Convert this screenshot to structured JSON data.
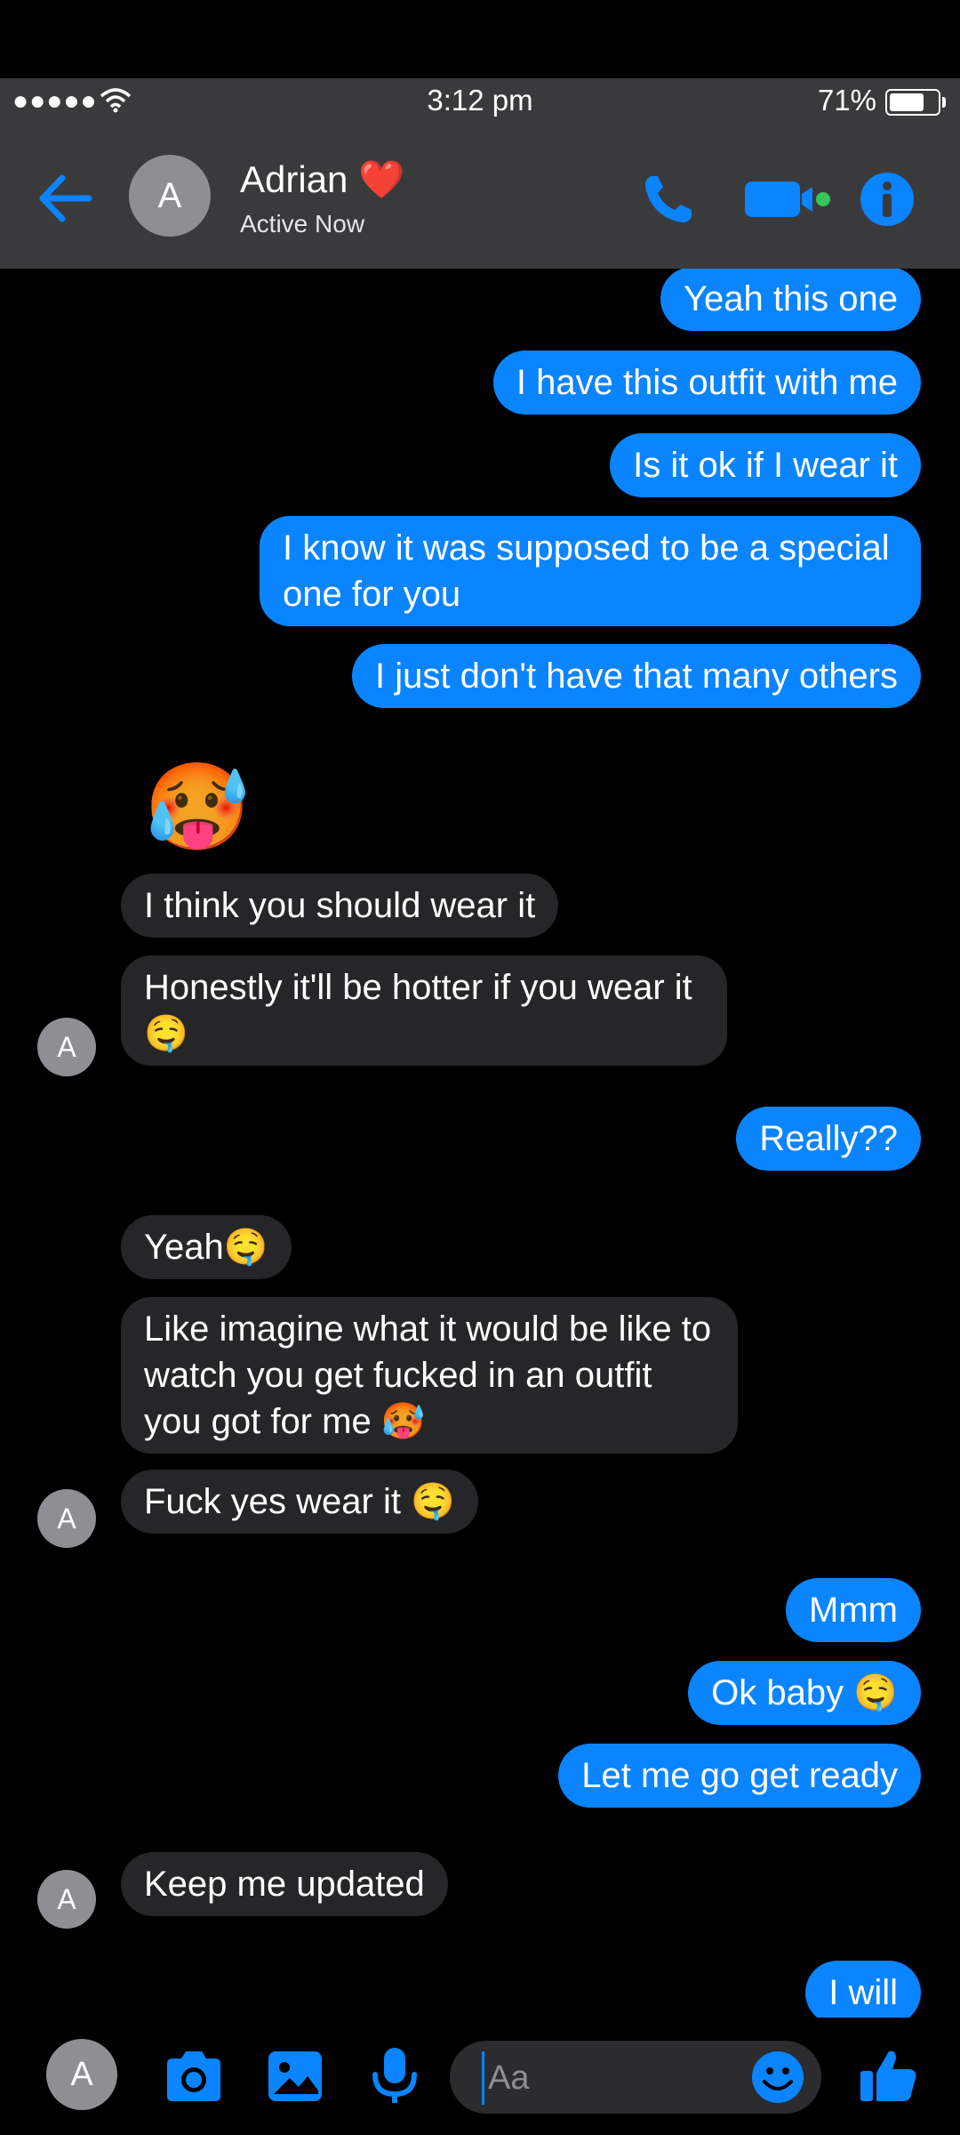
{
  "status_bar": {
    "signal": "●●●●●",
    "time": "3:12 pm",
    "battery_percent": "71%",
    "battery_level": 0.71
  },
  "header": {
    "contact_name": "Adrian",
    "name_emoji": "❤️",
    "contact_status": "Active Now",
    "avatar_initial": "A",
    "accent_color": "#0a84ff",
    "online_color": "#34c759"
  },
  "messages": [
    {
      "side": "out",
      "text": "Yeah this one"
    },
    {
      "side": "out",
      "text": "I have this outfit with me"
    },
    {
      "side": "out",
      "text": "Is it ok if I wear it"
    },
    {
      "side": "out",
      "text": "I know it was supposed to be a special one for you"
    },
    {
      "side": "out",
      "text": "I just don't have that many others"
    },
    {
      "side": "in",
      "text": "🥵"
    },
    {
      "side": "in",
      "text": "I think you should wear it"
    },
    {
      "side": "in",
      "text": "Honestly it'll be hotter if you wear it 🤤"
    },
    {
      "side": "out",
      "text": "Really??"
    },
    {
      "side": "in",
      "text": "Yeah🤤"
    },
    {
      "side": "in",
      "text": "Like imagine what it would be like to watch you get fucked in an outfit you got for me 🥵"
    },
    {
      "side": "in",
      "text": "Fuck yes wear it 🤤"
    },
    {
      "side": "out",
      "text": "Mmm"
    },
    {
      "side": "out",
      "text": "Ok baby 🤤"
    },
    {
      "side": "out",
      "text": "Let me go get ready"
    },
    {
      "side": "in",
      "text": "Keep me updated"
    },
    {
      "side": "out",
      "text": "I will"
    }
  ],
  "message_avatar_initial": "A",
  "composer": {
    "avatar_initial": "A",
    "placeholder": "Aa",
    "icons": [
      "camera-icon",
      "photo-icon",
      "microphone-icon",
      "emoji-icon",
      "thumbs-up-icon"
    ]
  }
}
